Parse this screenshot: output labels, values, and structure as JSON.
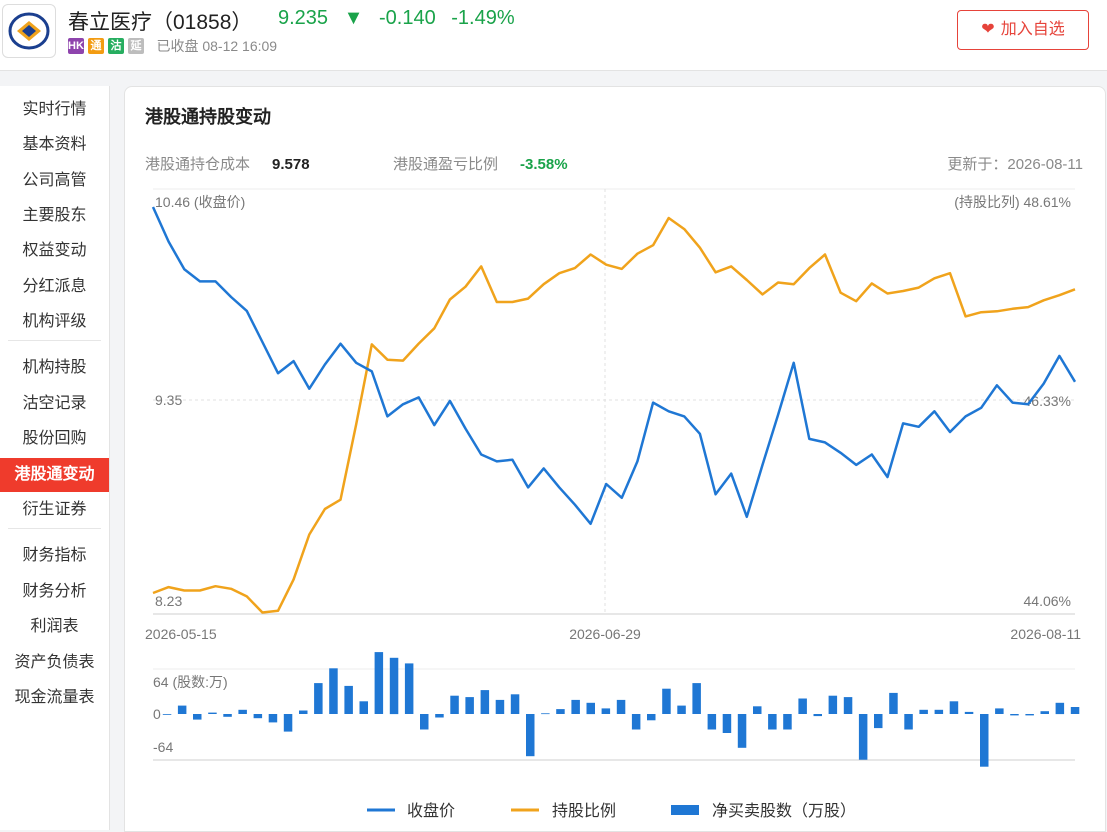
{
  "header": {
    "stock_name": "春立医疗（01858）",
    "price": "9.235",
    "change": "-0.140",
    "change_pct": "-1.49%",
    "badges": [
      {
        "text": "HK",
        "color": "#8e44ad"
      },
      {
        "text": "通",
        "color": "#f39c12"
      },
      {
        "text": "沽",
        "color": "#27ae60"
      },
      {
        "text": "延",
        "color": "#bdbdbd"
      }
    ],
    "status": "已收盘 08-12 16:09",
    "watch_button": "加入自选",
    "down_color": "#1aa34a",
    "accent_color": "#e6433a"
  },
  "sidebar": {
    "items": [
      "实时行情",
      "基本资料",
      "公司高管",
      "主要股东",
      "权益变动",
      "分红派息",
      "机构评级",
      "机构持股",
      "沽空记录",
      "股份回购",
      "港股通变动",
      "衍生证券",
      "财务指标",
      "财务分析",
      "利润表",
      "资产负债表",
      "现金流量表"
    ],
    "active": "港股通变动"
  },
  "panel": {
    "title": "港股通持股变动",
    "cost_label": "港股通持仓成本",
    "cost_value": "9.578",
    "pl_label": "港股通盈亏比例",
    "pl_value": "-3.58%",
    "updated": "更新于：2026-08-11"
  },
  "chart_data": {
    "type": "line",
    "x_ticks": [
      "2026-05-15",
      "2026-06-29",
      "2026-08-11"
    ],
    "left_axis": {
      "labels": [
        "10.46 (收盘价)",
        "9.35",
        "8.23"
      ],
      "range": [
        8.23,
        10.46
      ]
    },
    "right_axis": {
      "labels": [
        "(持股比列) 48.61%",
        "46.33%",
        "44.06%"
      ],
      "range": [
        44.06,
        48.61
      ]
    },
    "series": [
      {
        "name": "收盘价",
        "color": "#1f77d4",
        "values": [
          10.46,
          10.26,
          10.1,
          10.03,
          10.03,
          9.94,
          9.86,
          9.68,
          9.5,
          9.57,
          9.41,
          9.55,
          9.67,
          9.56,
          9.51,
          9.25,
          9.32,
          9.36,
          9.2,
          9.34,
          9.18,
          9.03,
          8.99,
          9.0,
          8.84,
          8.95,
          8.84,
          8.74,
          8.63,
          8.86,
          8.78,
          8.99,
          9.33,
          9.28,
          9.25,
          9.15,
          8.8,
          8.92,
          8.67,
          8.97,
          9.26,
          9.56,
          9.12,
          9.1,
          9.04,
          8.97,
          9.03,
          8.9,
          9.21,
          9.19,
          9.28,
          9.16,
          9.25,
          9.3,
          9.43,
          9.33,
          9.32,
          9.44,
          9.6,
          9.45
        ]
      },
      {
        "name": "持股比例",
        "color": "#f0a31c",
        "values": [
          44.06,
          44.13,
          44.09,
          44.09,
          44.14,
          44.11,
          44.02,
          43.83,
          43.85,
          44.22,
          44.75,
          45.05,
          45.16,
          46.05,
          46.99,
          46.81,
          46.8,
          47.0,
          47.18,
          47.52,
          47.67,
          47.91,
          47.49,
          47.49,
          47.53,
          47.7,
          47.83,
          47.89,
          48.05,
          47.93,
          47.88,
          48.06,
          48.16,
          48.48,
          48.35,
          48.13,
          47.84,
          47.91,
          47.75,
          47.58,
          47.72,
          47.7,
          47.89,
          48.05,
          47.6,
          47.5,
          47.71,
          47.59,
          47.62,
          47.66,
          47.77,
          47.83,
          47.32,
          47.37,
          47.38,
          47.41,
          47.43,
          47.51,
          47.57,
          47.64
        ]
      },
      {
        "name": "净买卖股数（万股）",
        "color": "#1f77d4",
        "values": [
          0,
          12,
          -8,
          2,
          -4,
          6,
          -6,
          -12,
          -25,
          5,
          44,
          65,
          40,
          18,
          88,
          80,
          72,
          -22,
          -5,
          26,
          24,
          34,
          20,
          28,
          -60,
          1,
          7,
          20,
          16,
          8,
          20,
          -22,
          -9,
          36,
          12,
          44,
          -22,
          -27,
          -48,
          11,
          -22,
          -22,
          22,
          -3,
          26,
          24,
          -65,
          -20,
          30,
          -22,
          6,
          6,
          18,
          3,
          -75,
          8,
          -2,
          -2,
          4,
          16,
          10
        ]
      }
    ],
    "bar_axis": {
      "labels": [
        "64 (股数:万)",
        "0",
        "-64"
      ],
      "range": [
        -64,
        64
      ]
    },
    "legend": [
      "收盘价",
      "持股比例",
      "净买卖股数（万股）"
    ]
  }
}
